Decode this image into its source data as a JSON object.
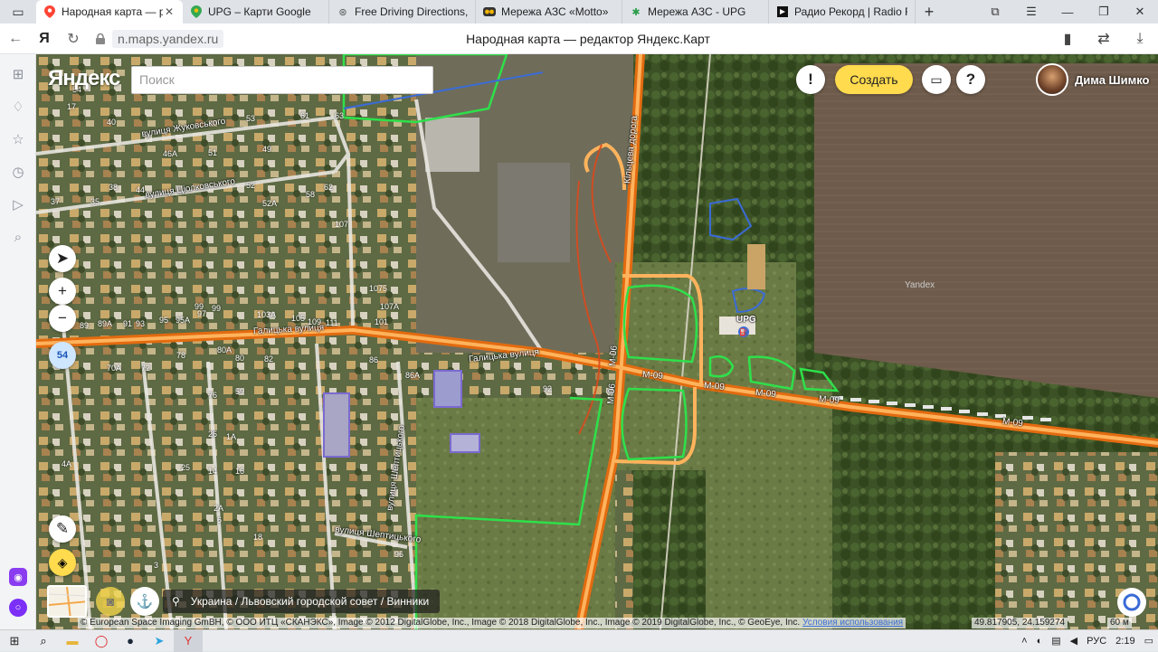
{
  "browser": {
    "tabs": [
      {
        "title": "Народная карта — ред",
        "icon": "yandex-map-icon",
        "active": true
      },
      {
        "title": "UPG – Карти Google",
        "icon": "google-maps-icon",
        "active": false
      },
      {
        "title": "Free Driving Directions, Tra",
        "icon": "driving-icon",
        "active": false
      },
      {
        "title": "Мережа АЗС «Motto»",
        "icon": "motto-icon",
        "active": false
      },
      {
        "title": "Мережа АЗС - UPG",
        "icon": "upg-icon",
        "active": false
      },
      {
        "title": "Радио Рекорд | Radio Rec",
        "icon": "radio-icon",
        "active": false
      }
    ],
    "url": "n.maps.yandex.ru",
    "page_title": "Народная карта — редактор Яндекс.Карт",
    "ya_letter": "Я"
  },
  "map": {
    "brand": "Яндекс",
    "search_placeholder": "Поиск",
    "alert_label": "!",
    "create_label": "Создать",
    "help_label": "?",
    "user_name": "Дима Шимко",
    "zoom_in": "+",
    "zoom_out": "−",
    "zoom_level": "54",
    "address": "Украина / Львовский городской совет / Винники",
    "copyright": "© European Space Imaging GmBH, © ООО ИТЦ «СКАНЭКС», Image © 2012 DigitalGlobe, Inc., Image © 2018 DigitalGlobe, Inc., Image © 2019 DigitalGlobe, Inc., © GeoEye, Inc.",
    "terms": "Условия использования",
    "coordinates": "49.817905, 24.159274",
    "scale": "60 м",
    "watermark": "Yandex",
    "poi_label": "UPG",
    "street_labels": {
      "zhukovskoho": "вулиця Жуковського",
      "tsiolkovskoho": "вулиця Ціолковського",
      "halytska_left": "Галицька вулиця",
      "halytska_mid": "Галицька вулиця",
      "sheptytskoho_v": "вулиця Шептицького",
      "sheptytskoho_h": "вулиця Шептицького",
      "kiltseva": "Кільцева дорога"
    },
    "road_labels": {
      "m06_a": "М-06",
      "m06_b": "М-06",
      "m09_a": "М-09",
      "m09_b": "М-09",
      "m09_c": "М-09",
      "m09_d": "М-09",
      "m09_e": "М-09"
    },
    "house_numbers": [
      "17",
      "54",
      "40",
      "53",
      "61",
      "63",
      "46А",
      "51",
      "49",
      "38",
      "37",
      "35",
      "44",
      "52",
      "52А",
      "58",
      "62",
      "107",
      "1075",
      "107А",
      "101",
      "103А",
      "105",
      "109",
      "111",
      "89",
      "89А",
      "91",
      "93",
      "95",
      "95А",
      "97",
      "99",
      "70А",
      "72",
      "80А",
      "80",
      "82",
      "86",
      "86А",
      "92",
      "99",
      "78",
      "76",
      "26",
      "25",
      "14",
      "16",
      "18",
      "96",
      "4А",
      "59",
      "1А",
      "2А",
      "6",
      "3"
    ]
  },
  "taskbar": {
    "language": "РУС",
    "time": "2:19"
  }
}
